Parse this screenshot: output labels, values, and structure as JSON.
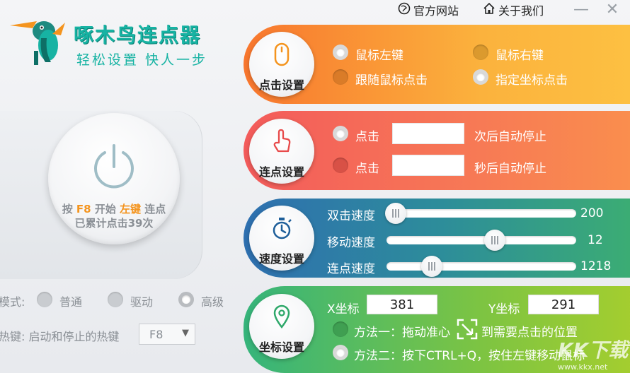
{
  "topbar": {
    "official_site": "官方网站",
    "about_us": "关于我们",
    "minimize": "—",
    "close": "✕"
  },
  "app": {
    "title": "啄木鸟连点器",
    "slogan": "轻松设置  快人一步"
  },
  "power": {
    "line1_prefix": "按 ",
    "hotkey": "F8",
    "line1_mid": " 开始 ",
    "button": "左键",
    "line1_suffix": " 连点",
    "line2": "已累计点击39次"
  },
  "mode": {
    "label": "模式:",
    "options": [
      "普通",
      "驱动",
      "高级"
    ],
    "selected": "高级"
  },
  "hotkey": {
    "label": "热键: 启动和停止的热键",
    "value": "F8"
  },
  "click_settings": {
    "title": "点击设置",
    "left_button": "鼠标左键",
    "right_button": "鼠标右键",
    "follow_mouse": "跟随鼠标点击",
    "fixed_coord": "指定坐标点击"
  },
  "continuous_settings": {
    "title": "连点设置",
    "click_label_1": "点击",
    "stop_after_times": "次后自动停止",
    "click_label_2": "点击",
    "stop_after_seconds": "秒后自动停止"
  },
  "speed_settings": {
    "title": "速度设置",
    "double_click_label": "双击速度",
    "double_click_value": "200",
    "double_click_fraction": 0.05,
    "move_label": "移动速度",
    "move_value": "12",
    "move_fraction": 0.57,
    "click_label": "连点速度",
    "click_value": "1218",
    "click_fraction": 0.24
  },
  "coord_settings": {
    "title": "坐标设置",
    "x_label": "X坐标",
    "x_value": "381",
    "y_label": "Y坐标",
    "y_value": "291",
    "method1": "方法一：拖动准心",
    "method1_suffix": "到需要点击的位置",
    "method2": "方法二：按下CTRL+Q，按住左键移动鼠标"
  },
  "watermark": {
    "brand": "KK下载",
    "url": "www.kkx.net"
  },
  "colors": {
    "teal": "#17b3a3",
    "orange": "#f4941e"
  }
}
